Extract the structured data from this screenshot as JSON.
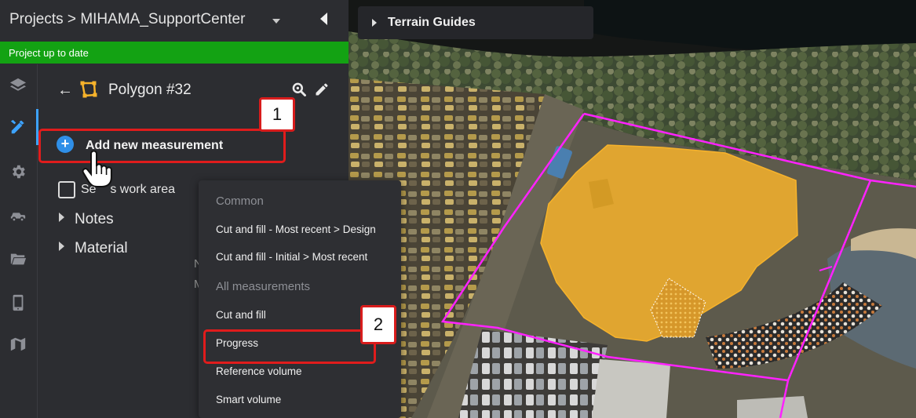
{
  "header": {
    "projects_label": "Projects",
    "separator": ">",
    "project_name": "MIHAMA_SupportCenter"
  },
  "status": {
    "text": "Project up to date",
    "color": "#13a213"
  },
  "rail": {
    "icons": [
      "layers-icon",
      "measure-tools-icon",
      "settings-icon",
      "vehicle-icon",
      "folder-icon",
      "mobile-icon",
      "map-icon"
    ],
    "active": "measure-tools-icon"
  },
  "polygon": {
    "title": "Polygon #32"
  },
  "actions": {
    "add_measurement": "Add new measurement"
  },
  "workarea": {
    "label": "Set as work area",
    "visible_label": "Se    s work area",
    "checked": false
  },
  "tree": [
    {
      "label": "Notes"
    },
    {
      "label": "Material"
    }
  ],
  "stray": {
    "a": "N",
    "b": "M"
  },
  "map": {
    "terrain_guides": "Terrain Guides"
  },
  "menu": {
    "section_common": "Common",
    "common_items": [
      "Cut and fill - Most recent > Design",
      "Cut and fill - Initial > Most recent"
    ],
    "section_all": "All measurements",
    "all_items": [
      "Cut and fill",
      "Progress",
      "Reference volume",
      "Smart volume"
    ]
  },
  "annotations": {
    "step1": "1",
    "step2": "2",
    "highlight_color": "#e01c1c"
  },
  "colors": {
    "accent": "#3da3ff",
    "polygon_fill": "#f7b32b",
    "boundary": "#ff22ff"
  }
}
